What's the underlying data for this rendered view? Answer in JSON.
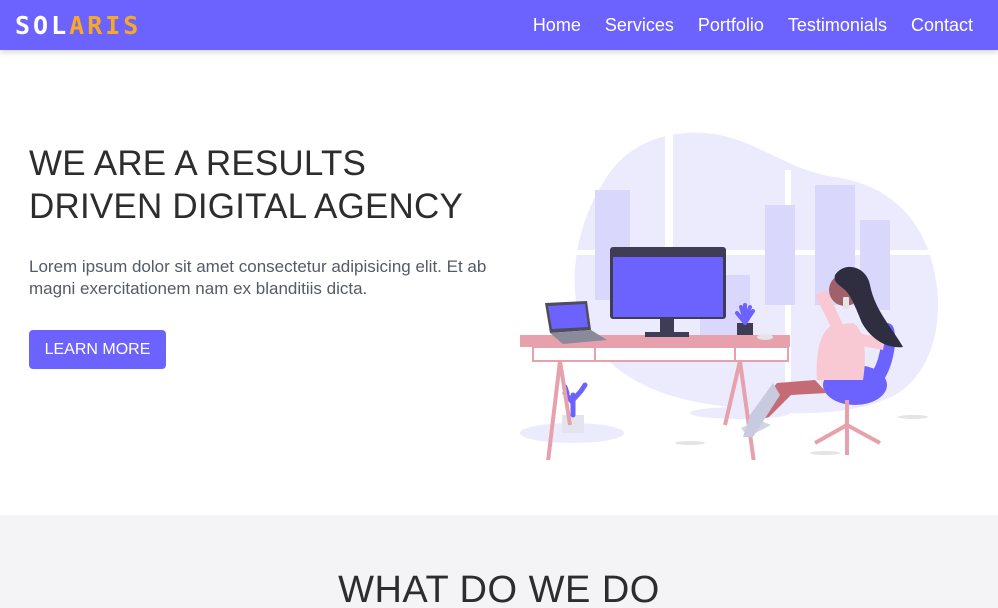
{
  "brand": {
    "part1": "SOL",
    "part2": "ARIS"
  },
  "nav": {
    "items": [
      {
        "label": "Home"
      },
      {
        "label": "Services"
      },
      {
        "label": "Portfolio"
      },
      {
        "label": "Testimonials"
      },
      {
        "label": "Contact"
      }
    ]
  },
  "hero": {
    "title": "WE ARE A RESULTS DRIVEN DIGITAL AGENCY",
    "text": "Lorem ipsum dolor sit amet consectetur adipisicing elit. Et ab magni exercitationem nam ex blanditiis dicta.",
    "button_label": "LEARN MORE"
  },
  "services": {
    "title": "WHAT DO WE DO"
  },
  "colors": {
    "accent": "#6c63ff",
    "brand_secondary": "#f9a826",
    "section_bg": "#f4f4f6"
  },
  "icons": {
    "illustration": "woman-at-desk-illustration"
  }
}
